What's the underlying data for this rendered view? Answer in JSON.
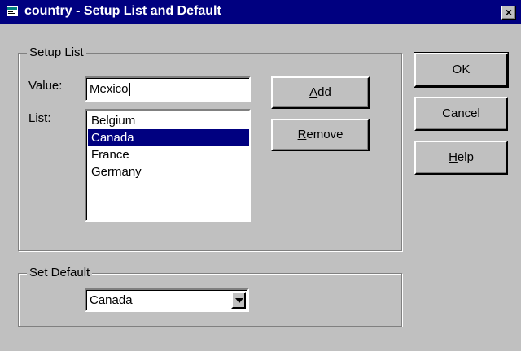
{
  "window": {
    "title": "country - Setup List and Default",
    "close_glyph": "×",
    "title_icon": "app-icon"
  },
  "setup_list": {
    "legend": "Setup List",
    "value_label": "Value:",
    "value": "Mexico",
    "list_label": "List:",
    "items": [
      "Belgium",
      "Canada",
      "France",
      "Germany"
    ],
    "selected_item": "Canada",
    "add_button": {
      "prefix": "",
      "mnemonic": "A",
      "rest": "dd"
    },
    "remove_button": {
      "prefix": "",
      "mnemonic": "R",
      "rest": "emove"
    }
  },
  "set_default": {
    "legend": "Set Default",
    "selected": "Canada"
  },
  "buttons": {
    "ok": "OK",
    "cancel": "Cancel",
    "help": {
      "prefix": "",
      "mnemonic": "H",
      "rest": "elp"
    }
  },
  "colors": {
    "title_bar": "#000080",
    "dialog_bg": "#c0c0c0",
    "selection": "#000080"
  }
}
